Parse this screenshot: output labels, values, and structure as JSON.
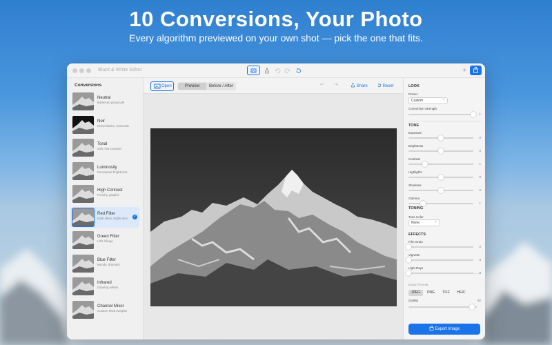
{
  "marketing": {
    "headline": "10 Conversions, Your Photo",
    "subline": "Every algorithm previewed on your own shot — pick the one that fits."
  },
  "colors": {
    "accent": "#1a73e8",
    "sky": "#3d8ad6"
  },
  "window": {
    "title": "Black & White Editor",
    "toolbar_icons": [
      "image-icon",
      "share-icon",
      "undo-icon",
      "redo-icon",
      "reset-icon",
      "plus-icon",
      "bag-icon"
    ]
  },
  "sidebar": {
    "heading": "Conversions",
    "items": [
      {
        "name": "Neutral",
        "desc": "Balanced grayscale",
        "selected": false
      },
      {
        "name": "Noir",
        "desc": "Deep blacks, cinematic",
        "selected": false
      },
      {
        "name": "Tonal",
        "desc": "Soft, low-contrast",
        "selected": false
      },
      {
        "name": "Luminosity",
        "desc": "Perceptual brightness",
        "selected": false
      },
      {
        "name": "High Contrast",
        "desc": "Punchy, graphic",
        "selected": false
      },
      {
        "name": "Red Filter",
        "desc": "Dark skies, bright skin",
        "selected": true
      },
      {
        "name": "Green Filter",
        "desc": "Lifts foliage",
        "selected": false
      },
      {
        "name": "Blue Filter",
        "desc": "Moody, dramatic",
        "selected": false
      },
      {
        "name": "Infrared",
        "desc": "Glowing whites",
        "selected": false
      },
      {
        "name": "Channel Mixer",
        "desc": "Custom RGB weights",
        "selected": false
      }
    ]
  },
  "editor": {
    "open_label": "Open",
    "preview_label": "Preview",
    "before_after_label": "Before / After",
    "share_label": "Share",
    "reset_label": "Reset"
  },
  "inspector": {
    "look": {
      "title": "LOOK",
      "preset_label": "Preset",
      "preset_value": "Custom",
      "strength_label": "Conversion Strength",
      "strength_value": "1",
      "strength_level": 1.0
    },
    "tone": {
      "title": "TONE",
      "sliders": [
        {
          "label": "Exposure",
          "value": "0",
          "level": 0.5
        },
        {
          "label": "Brightness",
          "value": "0",
          "level": 0.5
        },
        {
          "label": "Contrast",
          "value": "1",
          "level": 0.25
        },
        {
          "label": "Highlights",
          "value": "0",
          "level": 0.5
        },
        {
          "label": "Shadows",
          "value": "0",
          "level": 0.5
        },
        {
          "label": "Gamma",
          "value": "1",
          "level": 0.22
        }
      ]
    },
    "toning": {
      "title": "TONING",
      "tone_color_label": "Tone Color",
      "tone_color_value": "None"
    },
    "effects": {
      "title": "EFFECTS",
      "sliders": [
        {
          "label": "Film Grain",
          "value": "0",
          "level": 0.0
        },
        {
          "label": "Vignette",
          "value": "0",
          "level": 0.0
        },
        {
          "label": "Light Rays",
          "value": "0",
          "level": 0.0
        }
      ]
    },
    "export": {
      "format_label": "Export Format",
      "formats": [
        "JPEG",
        "PNG",
        "TIFF",
        "HEIC"
      ],
      "selected_format": "JPEG",
      "quality_label": "Quality",
      "quality_value": "92",
      "quality_level": 0.92,
      "button_label": "Export Image"
    }
  }
}
